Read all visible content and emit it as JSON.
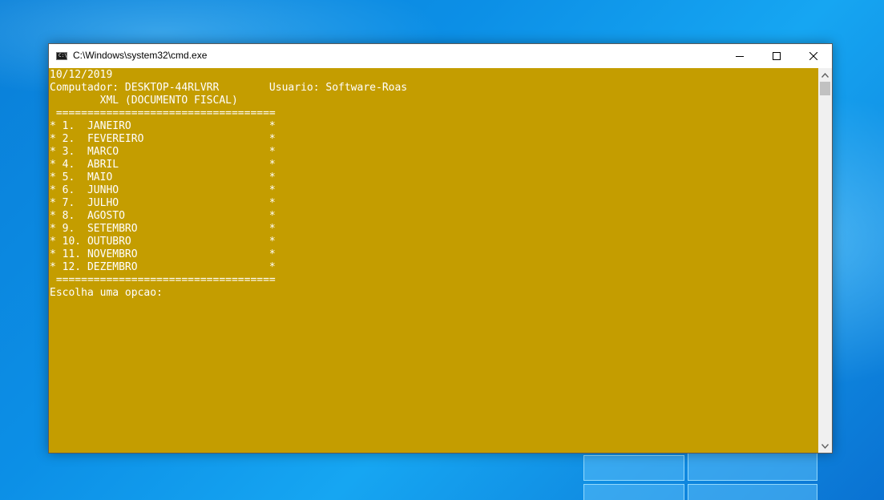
{
  "window": {
    "title": "C:\\Windows\\system32\\cmd.exe",
    "icon": "cmd-icon",
    "controls": [
      "minimize-icon",
      "maximize-icon",
      "close-icon"
    ]
  },
  "console": {
    "background_color": "#c49d00",
    "text_color": "#ffffff",
    "lines": [
      "10/12/2019",
      "Computador: DESKTOP-44RLVRR        Usuario: Software-Roas",
      "        XML (DOCUMENTO FISCAL)",
      " ===================================",
      "* 1.  JANEIRO                      *",
      "* 2.  FEVEREIRO                    *",
      "* 3.  MARCO                        *",
      "* 4.  ABRIL                        *",
      "* 5.  MAIO                         *",
      "* 6.  JUNHO                        *",
      "* 7.  JULHO                        *",
      "* 8.  AGOSTO                       *",
      "* 9.  SETEMBRO                     *",
      "* 10. OUTUBRO                      *",
      "* 11. NOVEMBRO                     *",
      "* 12. DEZEMBRO                     *",
      " ===================================",
      "Escolha uma opcao:"
    ]
  },
  "scrollbar": {
    "up_icon": "chevron-up-icon",
    "down_icon": "chevron-down-icon"
  }
}
